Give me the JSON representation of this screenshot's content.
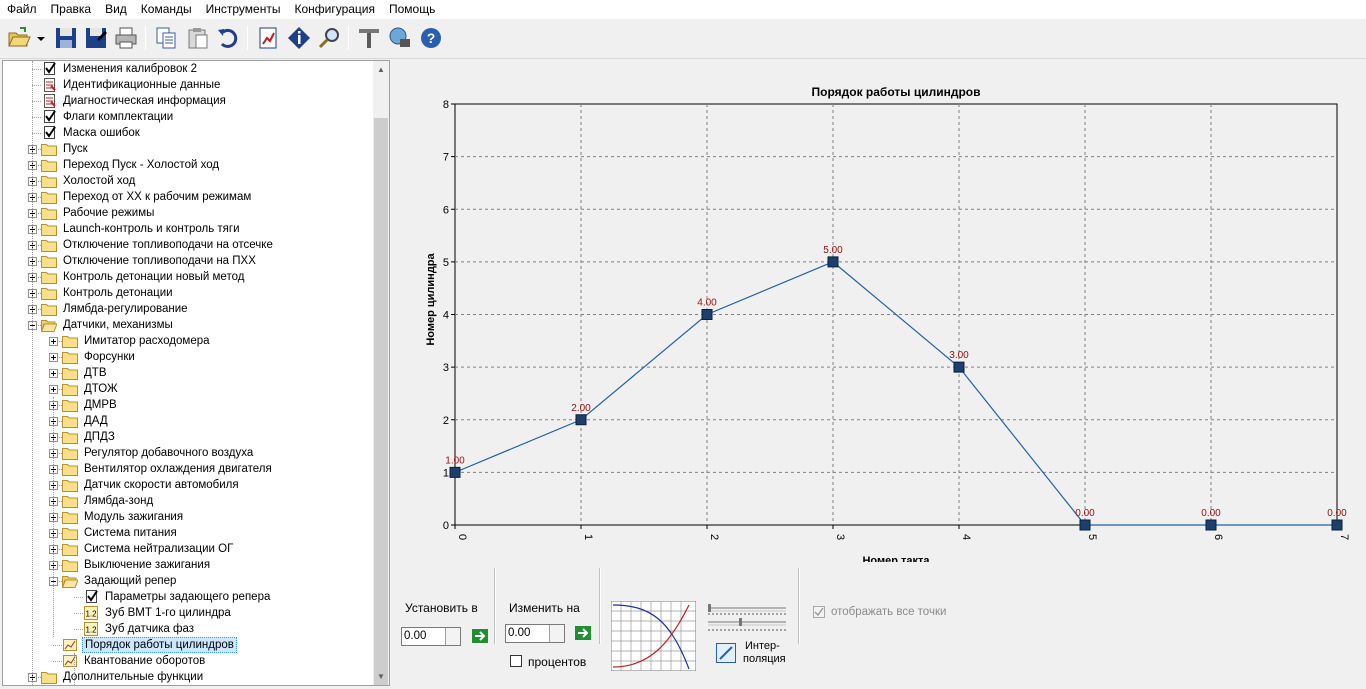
{
  "menu": [
    "Файл",
    "Правка",
    "Вид",
    "Команды",
    "Инструменты",
    "Конфигурация",
    "Помощь"
  ],
  "toolbar": {
    "buttons": [
      "open-icon",
      "dropdown-arrow-icon",
      "save-icon",
      "save-as-icon",
      "print-icon",
      "copy-icon",
      "paste-icon",
      "undo-icon",
      "report-icon",
      "info-icon",
      "search-icon",
      "tools-icon",
      "connect-icon",
      "help-icon"
    ]
  },
  "tree": {
    "items": [
      {
        "label": "Изменения калибровок 2",
        "level": 1,
        "icon": "checkbox-doc-icon",
        "expander": "none"
      },
      {
        "label": "Идентификационные данные",
        "level": 1,
        "icon": "doc-red-icon",
        "expander": "none"
      },
      {
        "label": "Диагностическая информация",
        "level": 1,
        "icon": "doc-red-icon",
        "expander": "none"
      },
      {
        "label": "Флаги комплектации",
        "level": 1,
        "icon": "checkbox-doc-icon",
        "expander": "none"
      },
      {
        "label": "Маска ошибок",
        "level": 1,
        "icon": "checkbox-doc-icon",
        "expander": "none"
      },
      {
        "label": "Пуск",
        "level": 1,
        "icon": "folder-icon",
        "expander": "plus"
      },
      {
        "label": "Переход Пуск - Холостой ход",
        "level": 1,
        "icon": "folder-icon",
        "expander": "plus"
      },
      {
        "label": "Холостой ход",
        "level": 1,
        "icon": "folder-icon",
        "expander": "plus"
      },
      {
        "label": "Переход от ХХ к рабочим режимам",
        "level": 1,
        "icon": "folder-icon",
        "expander": "plus"
      },
      {
        "label": "Рабочие режимы",
        "level": 1,
        "icon": "folder-icon",
        "expander": "plus"
      },
      {
        "label": "Launch-контроль и контроль тяги",
        "level": 1,
        "icon": "folder-icon",
        "expander": "plus"
      },
      {
        "label": "Отключение топливоподачи на отсечке",
        "level": 1,
        "icon": "folder-icon",
        "expander": "plus"
      },
      {
        "label": "Отключение топливоподачи на ПХХ",
        "level": 1,
        "icon": "folder-icon",
        "expander": "plus"
      },
      {
        "label": "Контроль детонации новый метод",
        "level": 1,
        "icon": "folder-icon",
        "expander": "plus"
      },
      {
        "label": "Контроль детонации",
        "level": 1,
        "icon": "folder-icon",
        "expander": "plus"
      },
      {
        "label": "Лямбда-регулирование",
        "level": 1,
        "icon": "folder-icon",
        "expander": "plus"
      },
      {
        "label": "Датчики, механизмы",
        "level": 1,
        "icon": "folder-open-icon",
        "expander": "minus"
      },
      {
        "label": "Имитатор расходомера",
        "level": 2,
        "icon": "folder-icon",
        "expander": "plus"
      },
      {
        "label": "Форсунки",
        "level": 2,
        "icon": "folder-icon",
        "expander": "plus"
      },
      {
        "label": "ДТВ",
        "level": 2,
        "icon": "folder-icon",
        "expander": "plus"
      },
      {
        "label": "ДТОЖ",
        "level": 2,
        "icon": "folder-icon",
        "expander": "plus"
      },
      {
        "label": "ДМРВ",
        "level": 2,
        "icon": "folder-icon",
        "expander": "plus"
      },
      {
        "label": "ДАД",
        "level": 2,
        "icon": "folder-icon",
        "expander": "plus"
      },
      {
        "label": "ДПДЗ",
        "level": 2,
        "icon": "folder-icon",
        "expander": "plus"
      },
      {
        "label": "Регулятор добавочного воздуха",
        "level": 2,
        "icon": "folder-icon",
        "expander": "plus"
      },
      {
        "label": "Вентилятор охлаждения двигателя",
        "level": 2,
        "icon": "folder-icon",
        "expander": "plus"
      },
      {
        "label": "Датчик скорости автомобиля",
        "level": 2,
        "icon": "folder-icon",
        "expander": "plus"
      },
      {
        "label": "Лямбда-зонд",
        "level": 2,
        "icon": "folder-icon",
        "expander": "plus"
      },
      {
        "label": "Модуль зажигания",
        "level": 2,
        "icon": "folder-icon",
        "expander": "plus"
      },
      {
        "label": "Система питания",
        "level": 2,
        "icon": "folder-icon",
        "expander": "plus"
      },
      {
        "label": "Система нейтрализации ОГ",
        "level": 2,
        "icon": "folder-icon",
        "expander": "plus"
      },
      {
        "label": "Выключение зажигания",
        "level": 2,
        "icon": "folder-icon",
        "expander": "plus"
      },
      {
        "label": "Задающий репер",
        "level": 2,
        "icon": "folder-open-icon",
        "expander": "minus"
      },
      {
        "label": "Параметры задающего репера",
        "level": 3,
        "icon": "checkbox-doc-icon",
        "expander": "none"
      },
      {
        "label": "Зуб ВМТ 1-го цилиндра",
        "level": 3,
        "icon": "value-icon",
        "expander": "none"
      },
      {
        "label": "Зуб датчика фаз",
        "level": 3,
        "icon": "value-icon",
        "expander": "none"
      },
      {
        "label": "Порядок работы цилиндров",
        "level": 2,
        "icon": "chart-icon",
        "expander": "none",
        "selected": true
      },
      {
        "label": "Квантование оборотов",
        "level": 2,
        "icon": "chart-icon",
        "expander": "none"
      },
      {
        "label": "Дополнительные функции",
        "level": 1,
        "icon": "folder-icon",
        "expander": "plus"
      }
    ]
  },
  "controls": {
    "set_label": "Установить в",
    "set_value": "0.00",
    "change_label": "Изменить на",
    "change_value": "0.00",
    "percent_label": "процентов",
    "interp_label_1": "Интер-",
    "interp_label_2": "поляция",
    "show_all_points_label": "отображать все точки"
  },
  "chart_data": {
    "type": "line",
    "title": "Порядок работы цилиндров",
    "xlabel": "Номер такта",
    "ylabel": "Номер цилиндра",
    "x": [
      0,
      1,
      2,
      3,
      4,
      5,
      6,
      7
    ],
    "values": [
      1,
      2,
      4,
      5,
      3,
      0,
      0,
      0
    ],
    "data_labels": [
      "1.00",
      "2.00",
      "4.00",
      "5.00",
      "3.00",
      "0.00",
      "0.00",
      "0.00"
    ],
    "xlim": [
      0,
      7
    ],
    "ylim": [
      0,
      8
    ],
    "xticks": [
      "0",
      "1",
      "2",
      "3",
      "4",
      "5",
      "6",
      "7"
    ],
    "yticks": [
      "0",
      "1",
      "2",
      "3",
      "4",
      "5",
      "6",
      "7",
      "8"
    ],
    "grid": true,
    "line_color": "#1f5fa8",
    "marker_color": "#1c3f6e",
    "label_color": "#a01010"
  }
}
